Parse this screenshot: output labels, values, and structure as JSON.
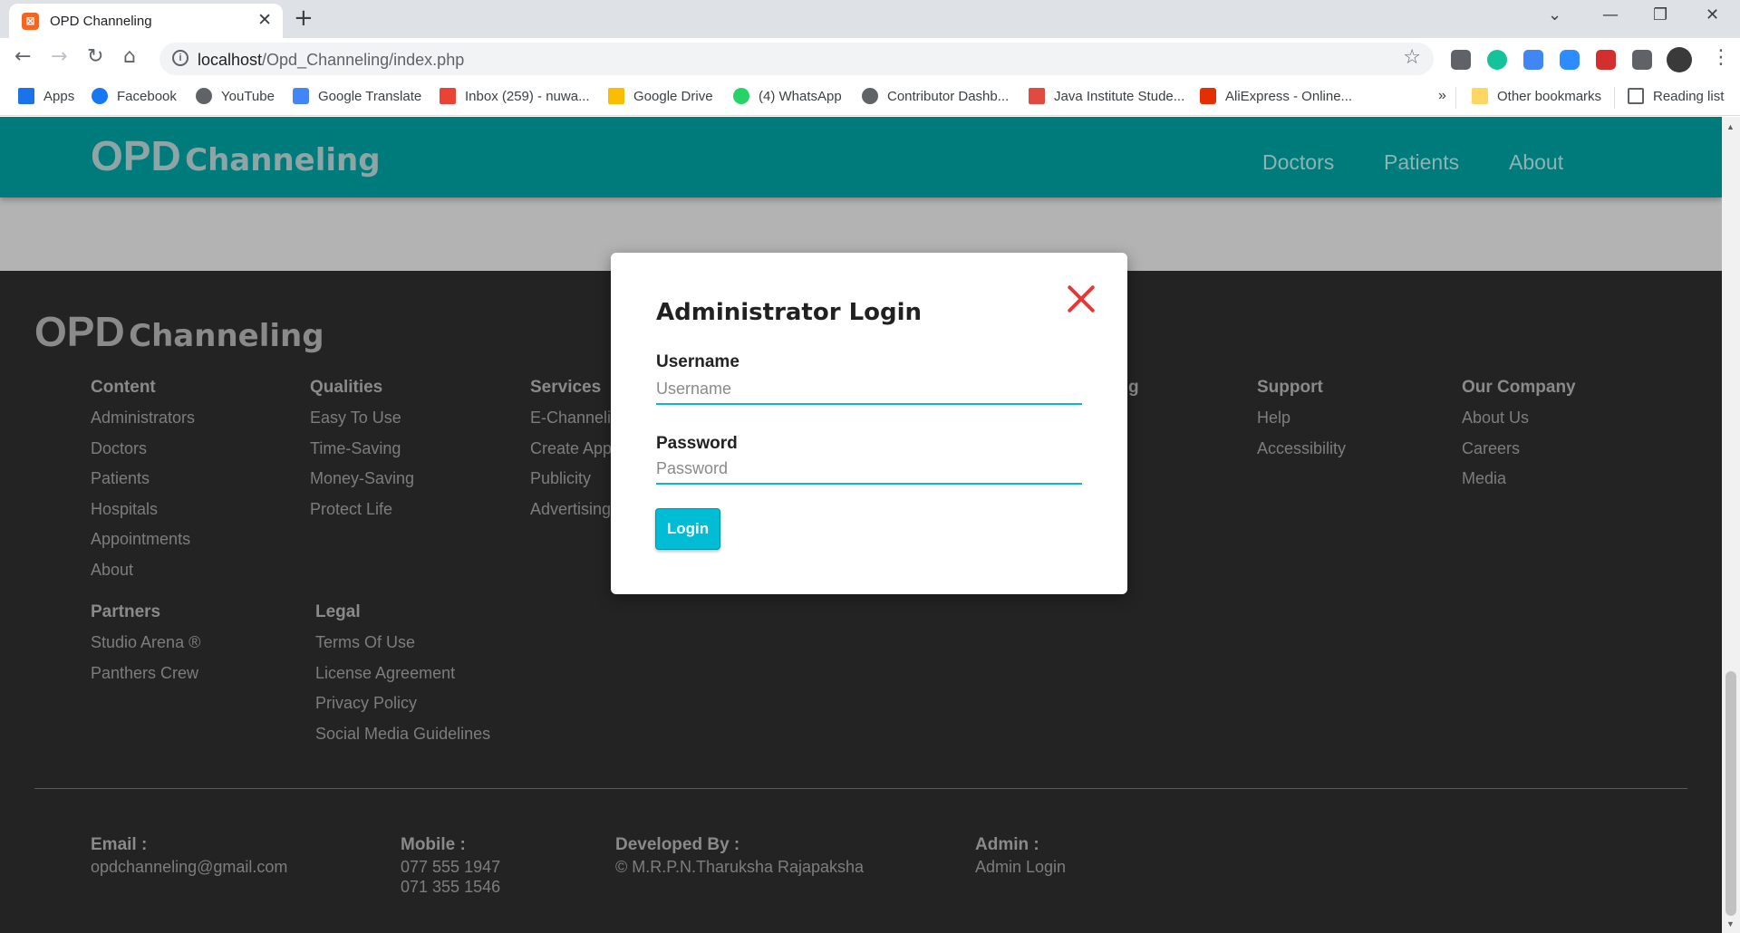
{
  "browser": {
    "tab_title": "OPD Channeling",
    "url_host": "localhost",
    "url_path": "/Opd_Channeling/index.php",
    "bookmarks": [
      {
        "label": "Apps",
        "icon": "apps-grid-icon",
        "color": "#1a73e8"
      },
      {
        "label": "Facebook",
        "icon": "facebook-icon",
        "color": "#1877f2"
      },
      {
        "label": "YouTube",
        "icon": "globe-icon",
        "color": "#5f6368"
      },
      {
        "label": "Google Translate",
        "icon": "translate-icon",
        "color": "#4285f4"
      },
      {
        "label": "Inbox (259) - nuwa...",
        "icon": "gmail-icon",
        "color": "#ea4335"
      },
      {
        "label": "Google Drive",
        "icon": "drive-icon",
        "color": "#fbbc04"
      },
      {
        "label": "(4) WhatsApp",
        "icon": "whatsapp-icon",
        "color": "#25d366"
      },
      {
        "label": "Contributor Dashb...",
        "icon": "globe-icon",
        "color": "#5f6368"
      },
      {
        "label": "Java Institute Stude...",
        "icon": "java-icon",
        "color": "#e04a3f"
      },
      {
        "label": "AliExpress - Online...",
        "icon": "aliexpress-icon",
        "color": "#e62e04"
      }
    ],
    "overflow": "»",
    "other_bookmarks": "Other bookmarks",
    "reading_list": "Reading list"
  },
  "site": {
    "brand_big": "OPD",
    "brand_small": "Channeling",
    "nav": [
      "Doctors",
      "Patients",
      "About"
    ]
  },
  "footer": {
    "brand_big": "OPD",
    "brand_small": "Channeling",
    "columns": [
      {
        "title": "Content",
        "links": [
          "Administrators",
          "Doctors",
          "Patients",
          "Hospitals",
          "Appointments",
          "About"
        ]
      },
      {
        "title": "Qualities",
        "links": [
          "Easy To Use",
          "Time-Saving",
          "Money-Saving",
          "Protect Life"
        ]
      },
      {
        "title": "Services",
        "links": [
          "E-Channeli",
          "Create App",
          "Publicity",
          "Advertising"
        ]
      },
      {
        "title": "g",
        "links": []
      },
      {
        "title": "Support",
        "links": [
          "Help",
          "Accessibility"
        ]
      },
      {
        "title": "Our Company",
        "links": [
          "About Us",
          "Careers",
          "Media"
        ]
      },
      {
        "title": "Partners",
        "links": [
          "Studio Arena ®",
          "Panthers Crew"
        ]
      },
      {
        "title": "Legal",
        "links": [
          "Terms Of Use",
          "License Agreement",
          "Privacy Policy",
          "Social Media Guidelines"
        ]
      }
    ],
    "contact": {
      "email_title": "Email :",
      "email": "opdchanneling@gmail.com",
      "mobile_title": "Mobile :",
      "mobile_1": "077 555 1947",
      "mobile_2": "071 355 1546",
      "dev_title": "Developed By :",
      "dev": "© M.R.P.N.Tharuksha Rajapaksha",
      "admin_title": "Admin :",
      "admin_link": "Admin Login"
    }
  },
  "modal": {
    "title": "Administrator Login",
    "username_label": "Username",
    "username_placeholder": "Username",
    "username_value": "",
    "password_label": "Password",
    "password_placeholder": "Password",
    "password_value": "",
    "login_label": "Login",
    "close_icon": "close-x-icon",
    "accent_color": "#00bcd4",
    "close_color": "#e53935"
  },
  "colors": {
    "navbar": "#007b7b",
    "footer": "#232323",
    "overlay": "#b3b3b3"
  }
}
